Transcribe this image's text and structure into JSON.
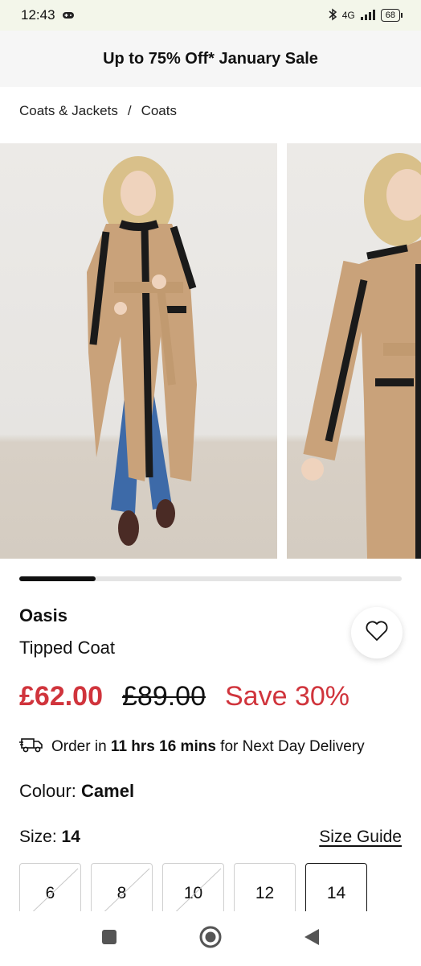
{
  "status_bar": {
    "time": "12:43",
    "network": "4G",
    "battery": "68"
  },
  "promo": {
    "text": "Up to 75% Off* January Sale"
  },
  "breadcrumb": {
    "items": [
      "Coats & Jackets",
      "/",
      "Coats"
    ]
  },
  "gallery": {
    "images": [
      "model-front-photo",
      "model-side-photo"
    ],
    "progress": 0.2
  },
  "product": {
    "brand": "Oasis",
    "name": "Tipped Coat",
    "price_now": "£62.00",
    "price_was": "£89.00",
    "save": "Save 30%"
  },
  "delivery": {
    "prefix": "Order in ",
    "time": "11 hrs 16 mins",
    "suffix": " for Next Day Delivery"
  },
  "colour": {
    "label": "Colour: ",
    "value": "Camel"
  },
  "size": {
    "label": "Size: ",
    "value": "14",
    "guide": "Size Guide",
    "options": [
      {
        "label": "6",
        "available": false
      },
      {
        "label": "8",
        "available": false
      },
      {
        "label": "10",
        "available": false
      },
      {
        "label": "12",
        "available": true
      },
      {
        "label": "14",
        "available": true,
        "selected": true
      }
    ]
  },
  "colors": {
    "sale_red": "#d0343c",
    "coat_camel": "#c9a27a"
  }
}
